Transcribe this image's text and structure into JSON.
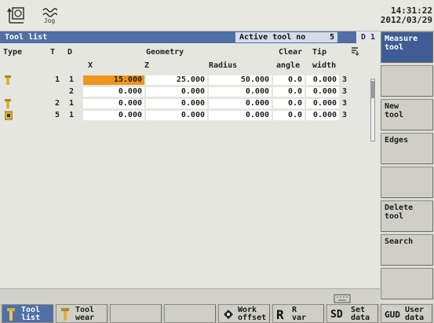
{
  "header": {
    "mode_label": "Jog",
    "time": "14:31:22",
    "date": "2012/03/29"
  },
  "titlebar": {
    "title": "Tool list",
    "active_tool_label": "Active tool no",
    "active_tool_value": "5",
    "active_d": "D 1"
  },
  "columns": {
    "type": "Type",
    "t": "T",
    "d": "D",
    "geometry": "Geometry",
    "clear": "Clear",
    "tip": "Tip",
    "x": "X",
    "z": "Z",
    "radius": "Radius",
    "angle": "angle",
    "width": "width"
  },
  "rows": [
    {
      "type_icon": "drill-tool-icon",
      "t": "1",
      "d": "1",
      "x": "15.000",
      "z": "25.000",
      "radius": "50.000",
      "angle": "0.0",
      "width": "0.000",
      "n": "3",
      "selected": true
    },
    {
      "type_icon": "",
      "t": "",
      "d": "2",
      "x": "0.000",
      "z": "0.000",
      "radius": "0.000",
      "angle": "0.0",
      "width": "0.000",
      "n": "3",
      "selected": false
    },
    {
      "type_icon": "drill-tool-icon",
      "t": "2",
      "d": "1",
      "x": "0.000",
      "z": "0.000",
      "radius": "0.000",
      "angle": "0.0",
      "width": "0.000",
      "n": "3",
      "selected": false
    },
    {
      "type_icon": "turning-tool-icon",
      "t": "5",
      "d": "1",
      "x": "0.000",
      "z": "0.000",
      "radius": "0.000",
      "angle": "0.0",
      "width": "0.000",
      "n": "3",
      "selected": false
    }
  ],
  "vertical_softkeys": [
    {
      "label": "Measure\ntool"
    },
    {
      "label": ""
    },
    {
      "label": "New\ntool"
    },
    {
      "label": "Edges"
    },
    {
      "label": ""
    },
    {
      "label": "Delete\ntool"
    },
    {
      "label": "Search"
    },
    {
      "label": ""
    }
  ],
  "horizontal_softkeys": [
    {
      "label": "Tool\nlist",
      "icon": "tool-list-icon",
      "active": true
    },
    {
      "label": "Tool\nwear",
      "icon": "tool-wear-icon",
      "active": false
    },
    {
      "label": "",
      "icon": "",
      "active": false
    },
    {
      "label": "",
      "icon": "",
      "active": false
    },
    {
      "label": "Work\noffset",
      "icon": "work-offset-icon",
      "active": false
    },
    {
      "label": "R\nvar",
      "icon": "r-variable-icon",
      "active": false
    },
    {
      "label": "Set\ndata",
      "icon": "setting-data-icon",
      "active": false
    },
    {
      "label": "User\ndata",
      "icon": "user-data-icon",
      "active": false
    }
  ],
  "colors": {
    "title_blue": "#4f6fa6",
    "selection_orange": "#f0941e"
  }
}
